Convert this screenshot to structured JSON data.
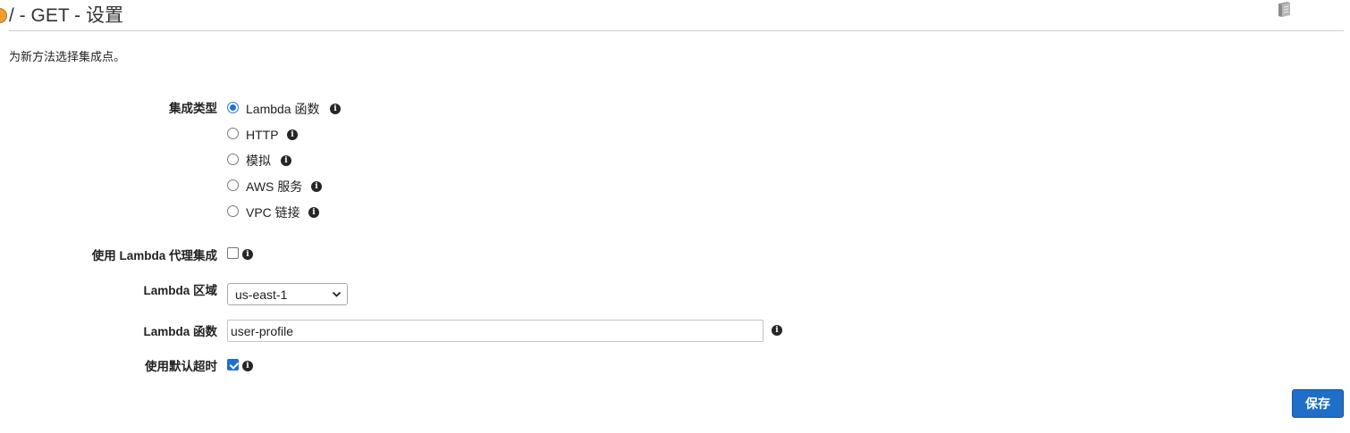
{
  "header": {
    "title": "/ - GET - 设置",
    "subtitle": "为新方法选择集成点。"
  },
  "form": {
    "integration_type": {
      "label": "集成类型",
      "options": [
        {
          "label": "Lambda 函数",
          "selected": true
        },
        {
          "label": "HTTP",
          "selected": false
        },
        {
          "label": "模拟",
          "selected": false
        },
        {
          "label": "AWS 服务",
          "selected": false
        },
        {
          "label": "VPC 链接",
          "selected": false
        }
      ]
    },
    "proxy": {
      "label": "使用 Lambda 代理集成",
      "checked": false
    },
    "region": {
      "label": "Lambda 区域",
      "value": "us-east-1"
    },
    "function": {
      "label": "Lambda 函数",
      "value": "user-profile"
    },
    "default_timeout": {
      "label": "使用默认超时",
      "checked": true
    }
  },
  "actions": {
    "save_label": "保存"
  },
  "colors": {
    "primary": "#1f6fc8",
    "accent_icon": "#f0a030"
  }
}
